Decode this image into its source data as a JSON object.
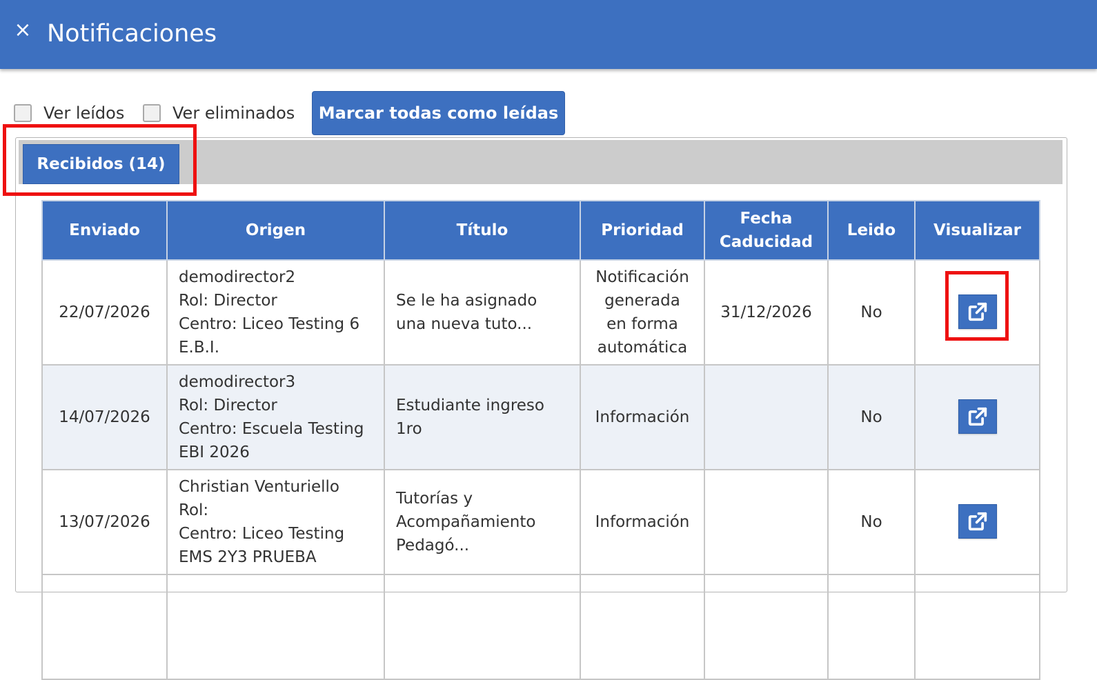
{
  "header": {
    "close_icon": "×",
    "title": "Notificaciones"
  },
  "filters": {
    "ver_leidos_label": "Ver leídos",
    "ver_eliminados_label": "Ver eliminados",
    "mark_all_label": "Marcar todas como leídas"
  },
  "tabs": {
    "received_label": "Recibidos (14)"
  },
  "table": {
    "headers": {
      "sent": "Enviado",
      "origin": "Origen",
      "title": "Título",
      "priority": "Prioridad",
      "expiry_line1": "Fecha",
      "expiry_line2": "Caducidad",
      "read": "Leido",
      "view": "Visualizar"
    },
    "rows": [
      {
        "sent": "22/07/2026",
        "origin_user": "demodirector2",
        "origin_role": "Rol: Director",
        "origin_center_line1": "Centro: Liceo Testing 6",
        "origin_center_line2": "E.B.I.",
        "title_line1": "Se le ha asignado",
        "title_line2": "una nueva tuto...",
        "priority_line1": "Notificación",
        "priority_line2": "generada",
        "priority_line3": "en forma",
        "priority_line4": "automática",
        "expiry": "31/12/2026",
        "read": "No"
      },
      {
        "sent": "14/07/2026",
        "origin_user": "demodirector3",
        "origin_role": "Rol: Director",
        "origin_center_line1": "Centro: Escuela Testing",
        "origin_center_line2": "EBI 2026",
        "title_line1": "Estudiante ingreso",
        "title_line2": "1ro",
        "priority": "Información",
        "expiry": "",
        "read": "No"
      },
      {
        "sent": "13/07/2026",
        "origin_user": "Christian Venturiello",
        "origin_role": "Rol:",
        "origin_center_line1": "Centro: Liceo Testing",
        "origin_center_line2": "EMS 2Y3 PRUEBA",
        "title_line1": "Tutorías y",
        "title_line2": "Acompañamiento",
        "title_line3": "Pedagó...",
        "priority": "Información",
        "expiry": "",
        "read": "No"
      }
    ]
  },
  "colors": {
    "primary": "#3d70c0",
    "highlight": "#ee1111",
    "tab_bar": "#cccccc",
    "row_alt": "#edf1f7"
  },
  "icons": {
    "close": "close-icon",
    "view": "external-link-icon"
  }
}
